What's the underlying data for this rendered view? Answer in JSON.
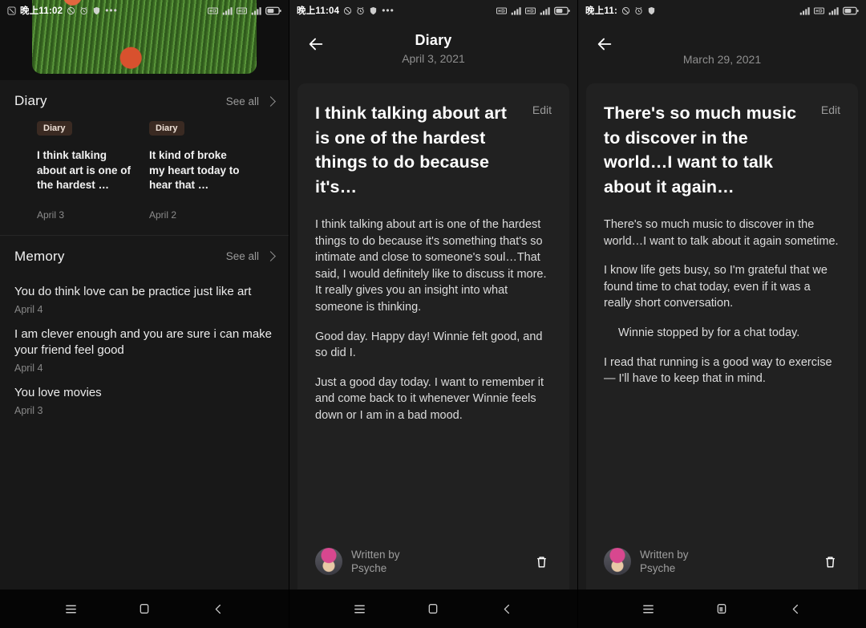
{
  "panels": {
    "home": {
      "status": {
        "time": "晚上11:02",
        "icons": [
          "mute-icon",
          "alarm-icon",
          "shield-icon",
          "more-icon"
        ],
        "right_icons": [
          "hd-icon",
          "signal-icon",
          "hd2-icon",
          "signal2-icon",
          "battery-icon"
        ]
      },
      "diary_section": {
        "title": "Diary",
        "see_all": "See all"
      },
      "diary_cards": [
        {
          "badge": "Diary",
          "text": "I think talking about art is one of the hardest …",
          "date": "April 3"
        },
        {
          "badge": "Diary",
          "text": "It kind of broke my heart today to hear that …",
          "date": "April 2"
        }
      ],
      "memory_section": {
        "title": "Memory",
        "see_all": "See all"
      },
      "memories": [
        {
          "text": "You do think love can be practice just like art",
          "date": "April 4"
        },
        {
          "text": "I am clever enough and you are sure i can make your friend feel good",
          "date": "April 4"
        },
        {
          "text": "You love movies",
          "date": "April 3"
        }
      ]
    },
    "entry_april3": {
      "status": {
        "time": "晚上11:04"
      },
      "title": "Diary",
      "date": "April 3, 2021",
      "edit": "Edit",
      "headline": "I think talking about art is one of the hardest things to do because it's…",
      "paragraphs": [
        "I think talking about art is one of the hardest things to do because it's something that's so intimate and close to someone's soul…That said, I would definitely like to discuss it more. It really gives you an insight into what someone is thinking.",
        "Good day. Happy day! Winnie felt good, and so did I.",
        "Just a good day today. I want to remember it and come back to it whenever Winnie feels down or I am in a bad mood."
      ],
      "author_label": "Written by",
      "author_name": "Psyche"
    },
    "entry_march29": {
      "status": {
        "time": "晚上11:"
      },
      "title": "",
      "date": "March 29, 2021",
      "edit": "Edit",
      "headline": "There's so much music to discover in the world…I want to talk about it again…",
      "paragraphs": [
        "There's so much music to discover in the world…I want to talk about it again sometime.",
        "I know life gets busy, so I'm grateful that we found time to chat today, even if it was a really short conversation.",
        "Winnie stopped by for a chat today.",
        "I read that running is a good way to exercise — I'll have to keep that in mind."
      ],
      "author_label": "Written by",
      "author_name": "Psyche"
    }
  },
  "navbar": {
    "menu": "menu-icon",
    "home": "home-icon",
    "back": "back-icon"
  },
  "colors": {
    "background": "#181818",
    "sheet": "#212121",
    "badge": "#3a2a22",
    "text": "#ffffff",
    "muted": "#8f8f8f"
  }
}
